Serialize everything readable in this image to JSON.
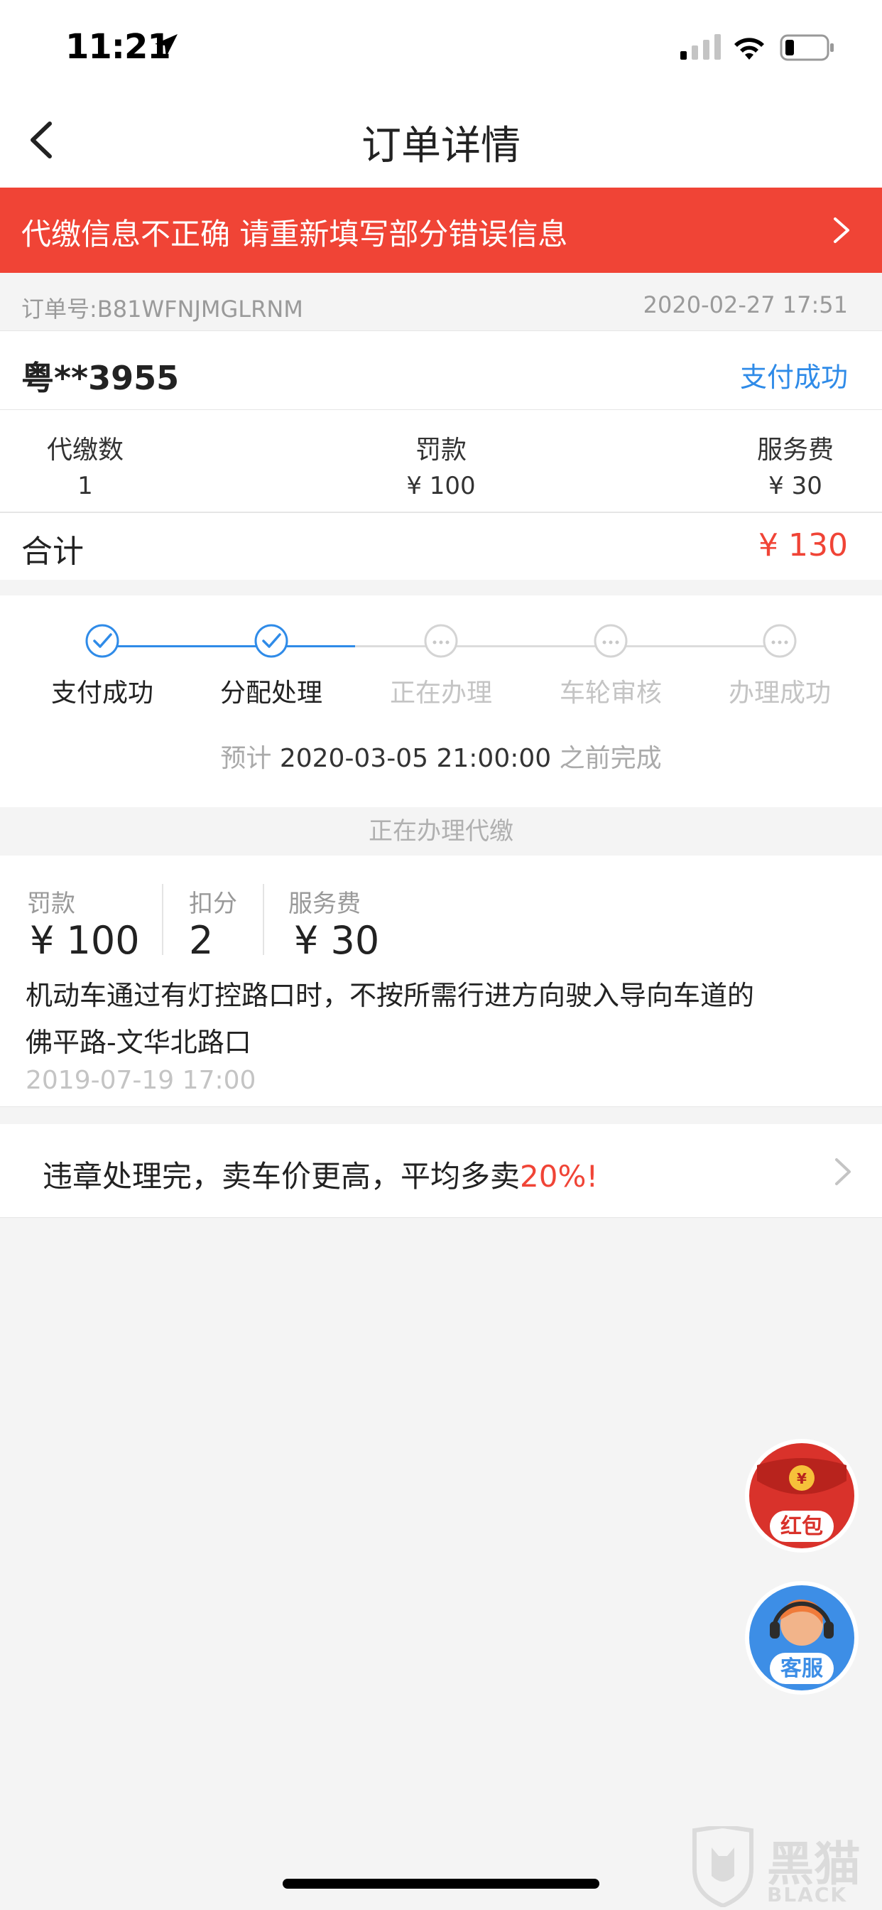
{
  "status_bar": {
    "time": "11:21"
  },
  "nav": {
    "title": "订单详情"
  },
  "banner": {
    "text": "代缴信息不正确 请重新填写部分错误信息"
  },
  "order": {
    "number": "订单号:B81WFNJMGLRNM",
    "datetime": "2020-02-27 17:51",
    "plate": "粤**3955",
    "status": "支付成功",
    "columns": [
      {
        "label": "代缴数",
        "value": "1"
      },
      {
        "label": "罚款",
        "value": "¥ 100"
      },
      {
        "label": "服务费",
        "value": "¥ 30"
      }
    ],
    "total_label": "合计",
    "total_value": "¥ 130"
  },
  "progress": {
    "steps": [
      {
        "label": "支付成功",
        "state": "done"
      },
      {
        "label": "分配处理",
        "state": "done"
      },
      {
        "label": "正在办理",
        "state": "pending"
      },
      {
        "label": "车轮审核",
        "state": "pending"
      },
      {
        "label": "办理成功",
        "state": "pending"
      }
    ],
    "estimate_prefix": "预计",
    "estimate_time": "2020-03-05 21:00:00",
    "estimate_suffix": "之前完成"
  },
  "section_header": "正在办理代缴",
  "violation": {
    "fine_label": "罚款",
    "fine_value": "¥ 100",
    "points_label": "扣分",
    "points_value": "2",
    "fee_label": "服务费",
    "fee_value": "¥ 30",
    "description": "机动车通过有灯控路口时，不按所需行进方向驶入导向车道的",
    "location": "佛平路-文华北路口",
    "date": "2019-07-19 17:00"
  },
  "ad": {
    "text": "违章处理完，卖车价更高，平均多卖",
    "highlight": "20%!"
  },
  "floating": {
    "redpacket_label": "红包",
    "service_label": "客服"
  },
  "watermark": {
    "text": "黑猫",
    "sub": "BLACK CAT"
  },
  "colors": {
    "accent_red": "#f04436",
    "accent_blue": "#2f8be8"
  }
}
